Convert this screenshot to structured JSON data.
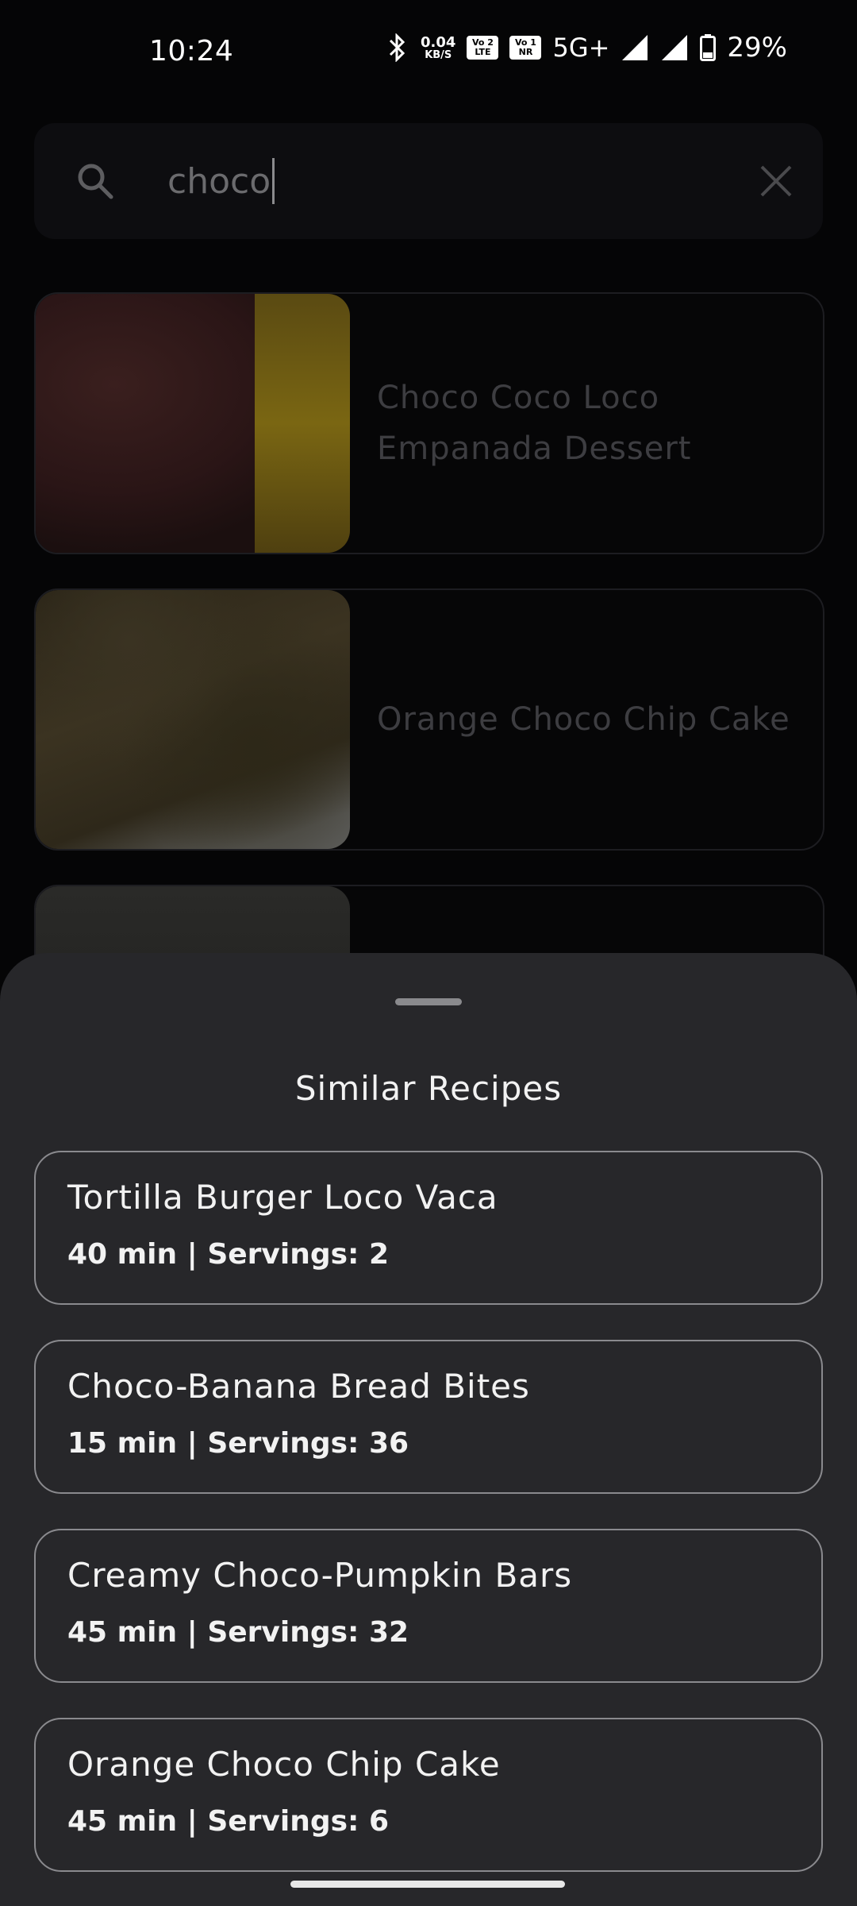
{
  "status_bar": {
    "time": "10:24",
    "net_speed_value": "0.04",
    "net_speed_unit": "KB/S",
    "volte_chip_1": "Vo 2 LTE",
    "volte_chip_2": "Vo 1 NR",
    "network": "5G+",
    "battery": "29%"
  },
  "search": {
    "value": "choco"
  },
  "results": [
    {
      "title": "Choco Coco Loco Empanada Dessert"
    },
    {
      "title": "Orange Choco Chip Cake"
    },
    {
      "title": ""
    }
  ],
  "sheet": {
    "title": "Similar Recipes",
    "items": [
      {
        "title": "Tortilla Burger Loco Vaca",
        "meta": "40 min | Servings: 2"
      },
      {
        "title": "Choco-Banana Bread Bites",
        "meta": "15 min | Servings: 36"
      },
      {
        "title": "Creamy Choco-Pumpkin Bars",
        "meta": "45 min | Servings: 32"
      },
      {
        "title": "Orange Choco Chip Cake",
        "meta": "45 min | Servings: 6"
      }
    ]
  },
  "colors": {
    "background": "#050506",
    "sheet": "#27272a",
    "card_border": "#8a8a8e",
    "dim_text": "#3d3d41"
  }
}
